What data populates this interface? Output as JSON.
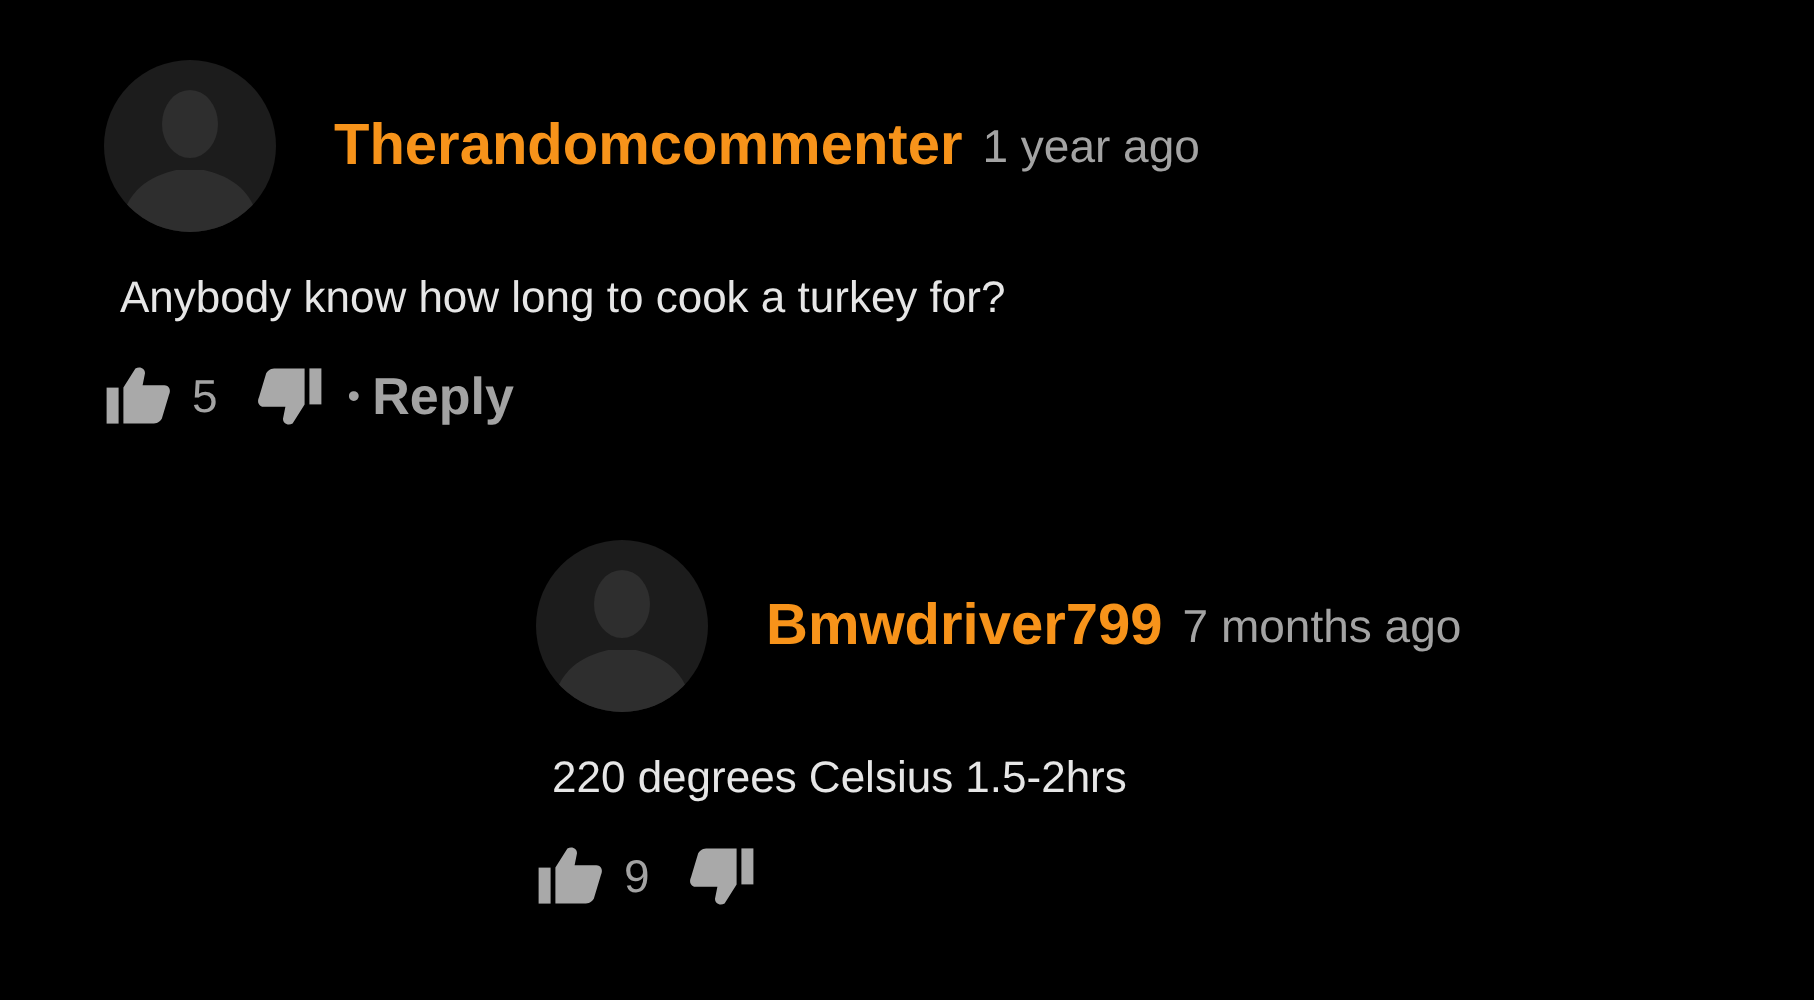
{
  "comments": [
    {
      "author": "Therandomcommenter",
      "time": "1 year ago",
      "text": "Anybody know how long to cook a turkey for?",
      "likes": "5",
      "separator": "•",
      "reply": "Reply",
      "children": [
        {
          "author": "Bmwdriver799",
          "time": "7 months ago",
          "text": "220 degrees Celsius 1.5-2hrs",
          "likes": "9"
        }
      ]
    }
  ]
}
